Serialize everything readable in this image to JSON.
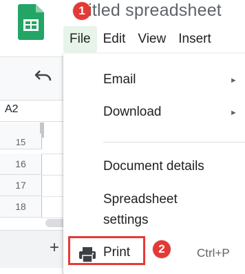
{
  "app": {
    "doc_title": "titled spreadsheet"
  },
  "menu_bar": {
    "items": [
      {
        "label": "File",
        "active": true
      },
      {
        "label": "Edit"
      },
      {
        "label": "View"
      },
      {
        "label": "Insert"
      }
    ]
  },
  "callouts": {
    "first": "1",
    "second": "2"
  },
  "sheet": {
    "name_box": "A2",
    "rows": [
      "15",
      "16",
      "17",
      "18"
    ],
    "add_sheet": "+"
  },
  "file_menu": {
    "items": [
      {
        "label": "Email",
        "submenu": true
      },
      {
        "label": "Download",
        "submenu": true
      },
      {
        "label": "Document details"
      },
      {
        "label": "Spreadsheet"
      },
      {
        "label": "settings"
      },
      {
        "label": "Print",
        "shortcut": "Ctrl+P",
        "highlighted": true
      }
    ],
    "submenu_arrow": "►"
  },
  "colors": {
    "sheets_green": "#23a566",
    "callout_red": "#e53935",
    "active_menu_bg": "#e6f4ea"
  },
  "icons": [
    "sheets-logo-icon",
    "undo-icon",
    "print-icon",
    "submenu-arrow-icon"
  ]
}
